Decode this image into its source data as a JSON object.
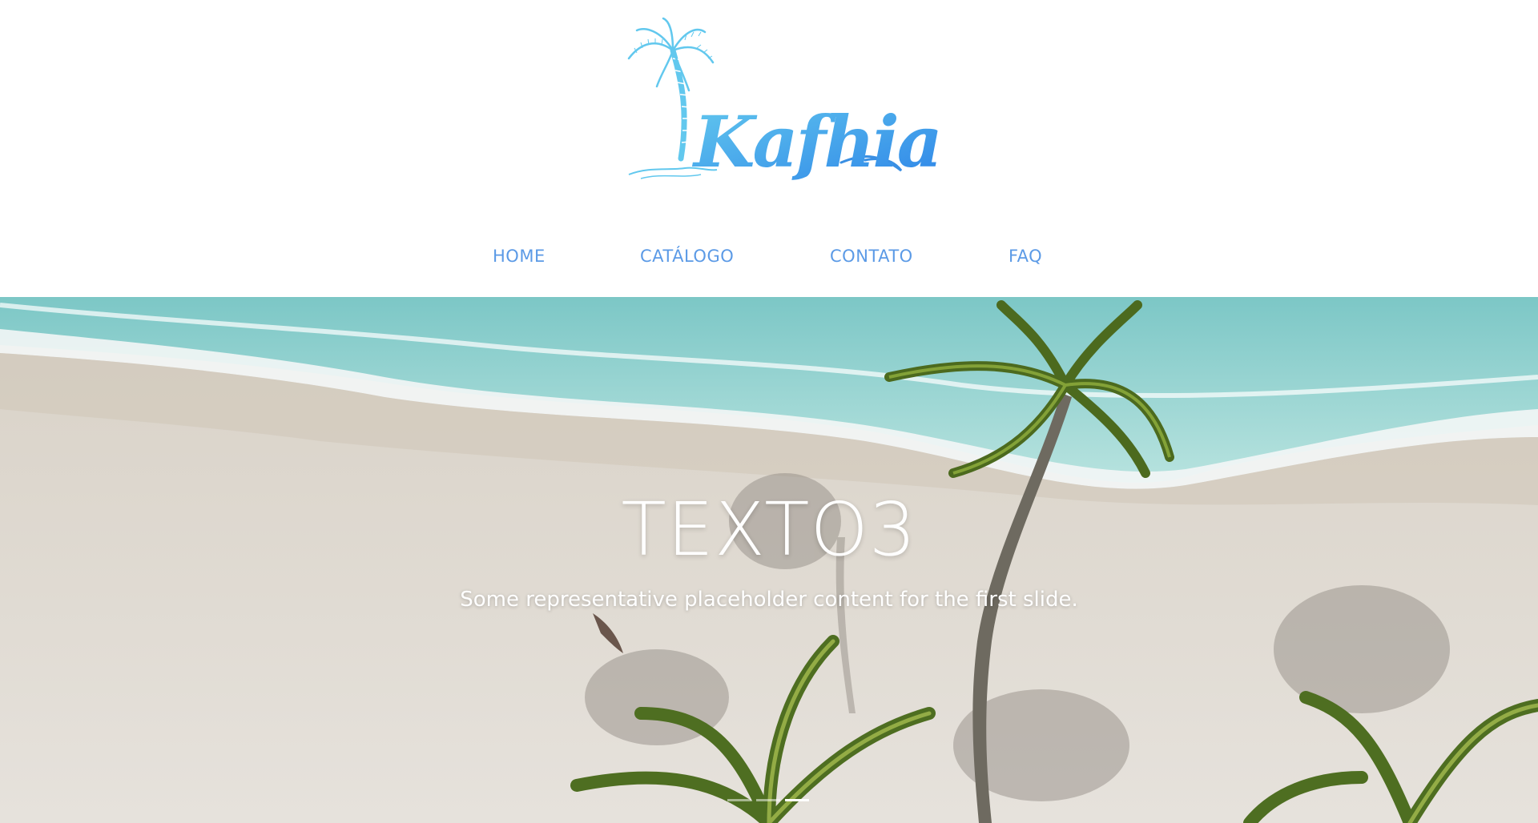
{
  "brand": {
    "name": "Kafhia",
    "colors": {
      "primary": "#3a8fe3",
      "light": "#62c8ee",
      "nav": "#5b9ae6"
    }
  },
  "nav": {
    "items": [
      {
        "label": "HOME"
      },
      {
        "label": "CATÁLOGO"
      },
      {
        "label": "CONTATO"
      },
      {
        "label": "FAQ"
      }
    ]
  },
  "carousel": {
    "title": "TEXTO3",
    "caption": "Some representative placeholder content for the first slide.",
    "slide_count": 3,
    "active_index": 3
  }
}
